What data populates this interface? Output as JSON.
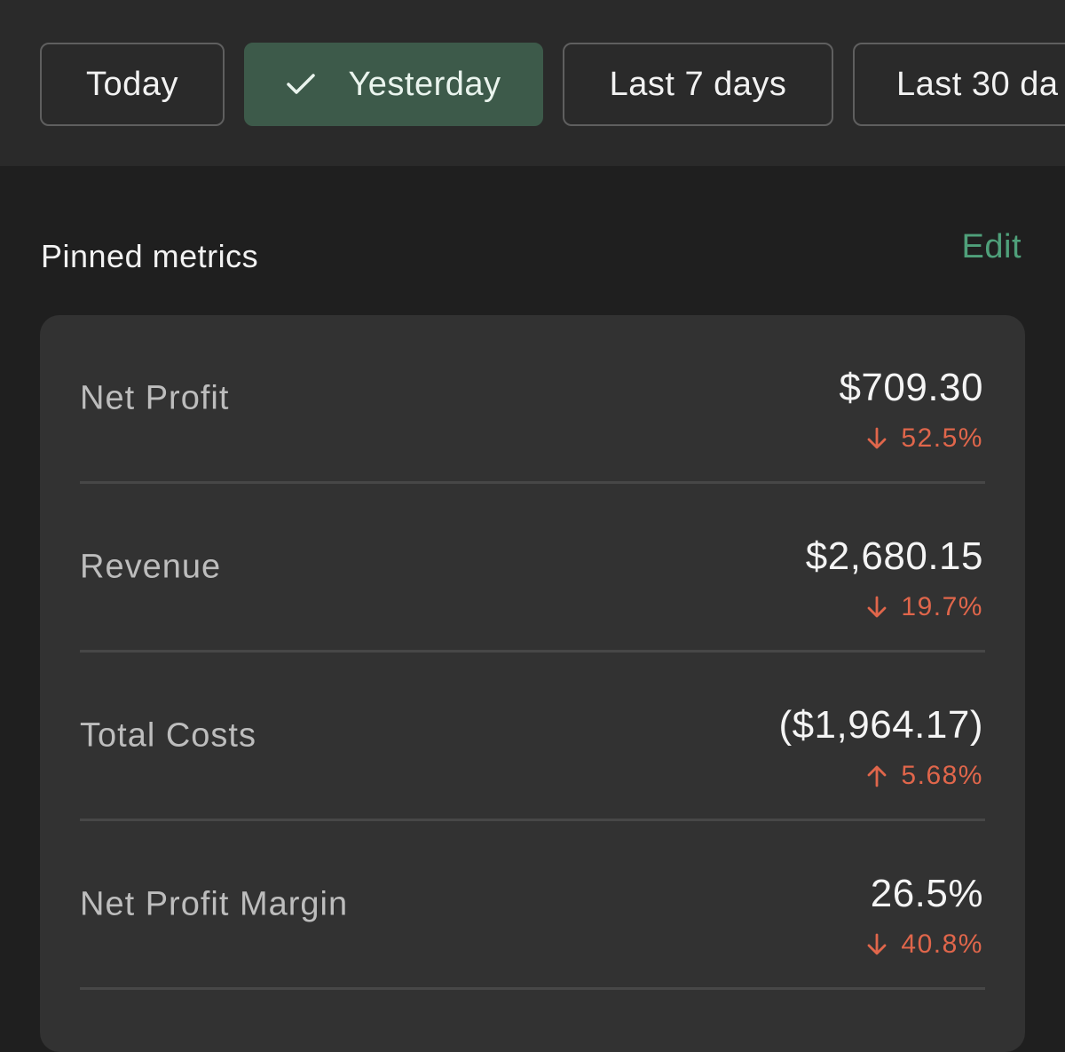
{
  "filters": {
    "today": "Today",
    "yesterday": "Yesterday",
    "last7": "Last 7 days",
    "last30": "Last 30 da"
  },
  "pinned": {
    "title": "Pinned metrics",
    "edit_label": "Edit",
    "metrics": [
      {
        "label": "Net Profit",
        "value": "$709.30",
        "change": "52.5%",
        "direction": "down"
      },
      {
        "label": "Revenue",
        "value": "$2,680.15",
        "change": "19.7%",
        "direction": "down"
      },
      {
        "label": "Total Costs",
        "value": "($1,964.17)",
        "change": "5.68%",
        "direction": "up"
      },
      {
        "label": "Net Profit Margin",
        "value": "26.5%",
        "change": "40.8%",
        "direction": "down"
      }
    ]
  },
  "colors": {
    "accent": "#4fa07a",
    "active_filter_bg": "#3d5a4a",
    "negative": "#e0664b"
  }
}
